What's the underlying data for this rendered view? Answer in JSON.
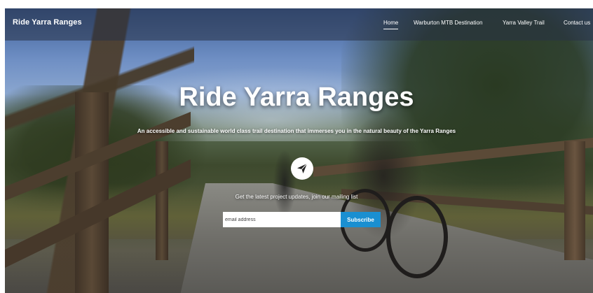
{
  "brand": {
    "name": "Ride Yarra Ranges"
  },
  "nav": {
    "items": [
      {
        "label": "Home",
        "active": true
      },
      {
        "label": "Warburton MTB Destination",
        "active": false
      },
      {
        "label": "Yarra Valley Trail",
        "active": false
      },
      {
        "label": "Contact us",
        "active": false
      }
    ]
  },
  "hero": {
    "title": "Ride Yarra Ranges",
    "subtitle": "An accessible and sustainable world class trail destination that immerses you in the natural beauty of the Yarra Ranges",
    "icon": "paper-plane-icon"
  },
  "signup": {
    "prompt": "Get the latest project updates, join our mailing list",
    "email_placeholder": "email address",
    "button_label": "Subscribe"
  },
  "colors": {
    "accent": "#1a8fd1",
    "header_overlay": "#28324699"
  }
}
